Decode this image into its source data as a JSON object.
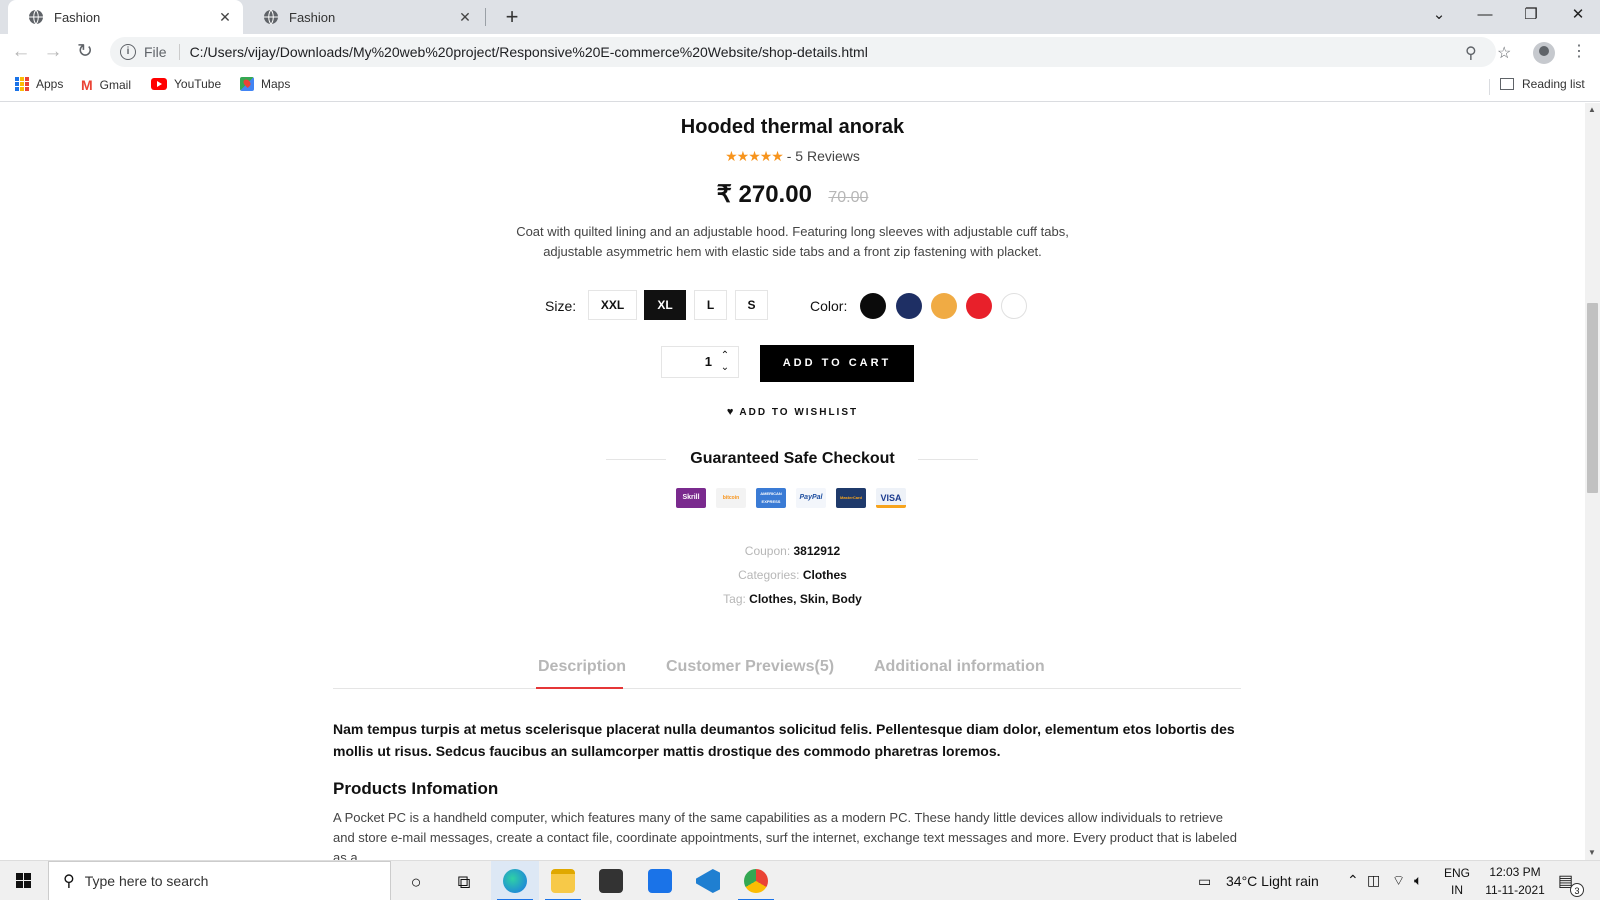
{
  "browser": {
    "tabs": [
      {
        "title": "Fashion",
        "active": true
      },
      {
        "title": "Fashion",
        "active": false
      }
    ],
    "file_label": "File",
    "url": "C:/Users/vijay/Downloads/My%20web%20project/Responsive%20E-commerce%20Website/shop-details.html",
    "bookmarks": [
      "Apps",
      "Gmail",
      "YouTube",
      "Maps"
    ],
    "reading_list": "Reading list"
  },
  "product": {
    "title": "Hooded thermal anorak",
    "reviews": "- 5 Reviews",
    "stars": "★★★★★",
    "price": "₹ 270.00",
    "old_price": "70.00",
    "description": "Coat with quilted lining and an adjustable hood. Featuring long sleeves with adjustable cuff tabs, adjustable asymmetric hem with elastic side tabs and a front zip fastening with placket.",
    "size_label": "Size:",
    "sizes": [
      "XXL",
      "XL",
      "L",
      "S"
    ],
    "selected_size": "XL",
    "color_label": "Color:",
    "colors": [
      "#0b0b0b",
      "#1e2f64",
      "#f0ab44",
      "#e8202a",
      "#ffffff"
    ],
    "quantity": "1",
    "add_to_cart": "ADD TO CART",
    "wishlist": "ADD TO WISHLIST",
    "checkout_title": "Guaranteed Safe Checkout",
    "payments": [
      "Skrill",
      "bitcoin",
      "AMERICAN EXPRESS",
      "PayPal",
      "MasterCard",
      "VISA"
    ],
    "coupon_label": "Coupon:",
    "coupon_value": "3812912",
    "categories_label": "Categories:",
    "categories_value": "Clothes",
    "tag_label": "Tag:",
    "tag_value": "Clothes, Skin, Body"
  },
  "details": {
    "tabs": [
      "Description",
      "Customer Previews(5)",
      "Additional information"
    ],
    "active_tab": "Description",
    "bold_paragraph": "Nam tempus turpis at metus scelerisque placerat nulla deumantos solicitud felis. Pellentesque diam dolor, elementum etos lobortis des mollis ut risus. Sedcus faucibus an sullamcorper mattis drostique des commodo pharetras loremos.",
    "info_heading": "Products Infomation",
    "info_paragraph": "A Pocket PC is a handheld computer, which features many of the same capabilities as a modern PC. These handy little devices allow individuals to retrieve and store e-mail messages, create a contact file, coordinate appointments, surf the internet, exchange text messages and more. Every product that is labeled as a"
  },
  "taskbar": {
    "search_placeholder": "Type here to search",
    "weather": "34°C  Light rain",
    "lang_top": "ENG",
    "lang_bottom": "IN",
    "time": "12:03 PM",
    "date": "11-11-2021",
    "notification_count": "3"
  }
}
